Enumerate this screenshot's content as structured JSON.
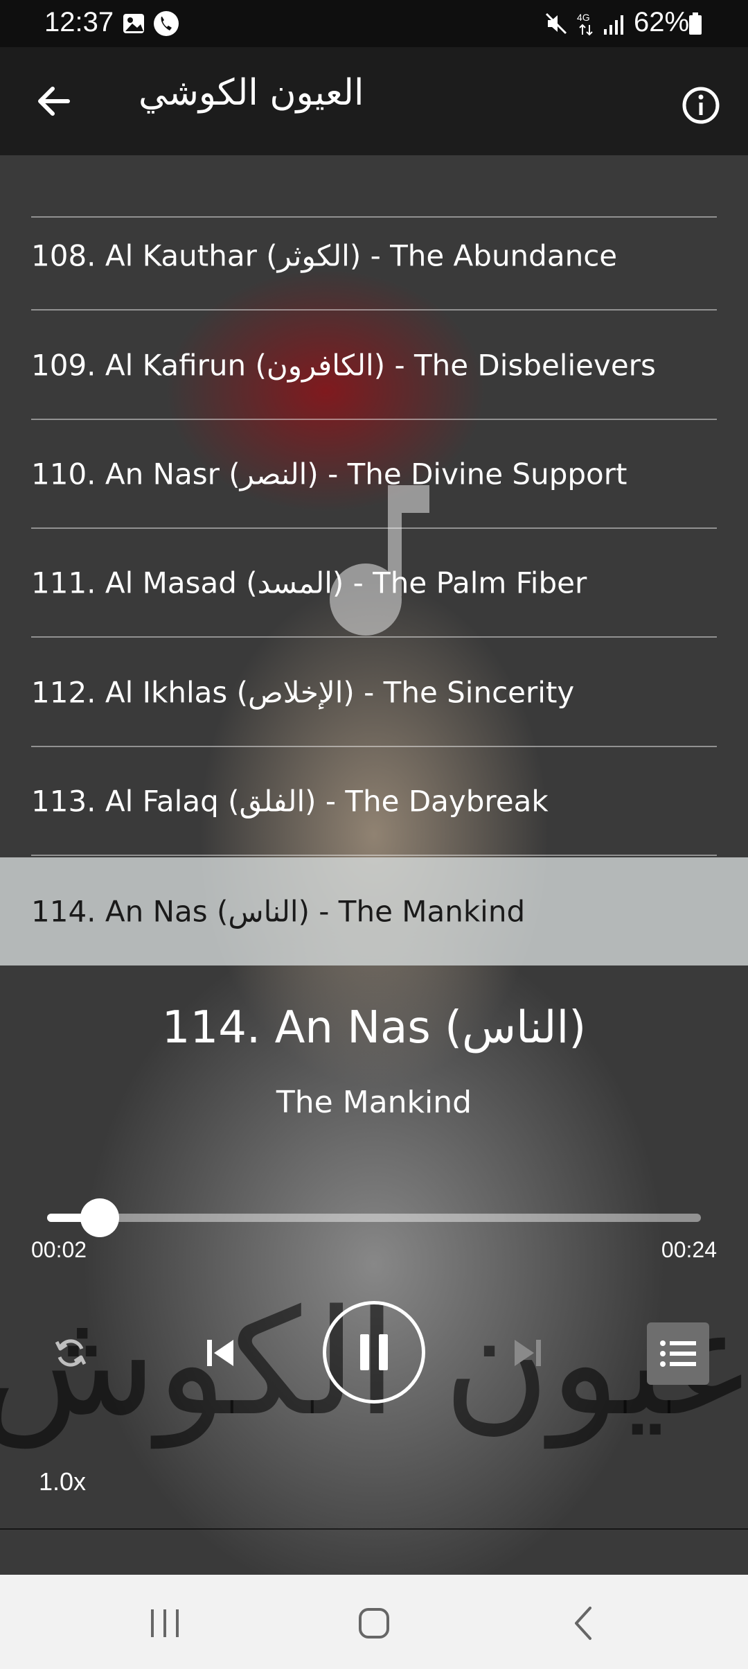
{
  "status": {
    "time": "12:37",
    "battery": "62%",
    "network": "4G"
  },
  "appbar": {
    "title": "العيون الكوشي"
  },
  "tracks": [
    {
      "label": "108. Al Kauthar (الكوثر) - The Abundance"
    },
    {
      "label": "109. Al Kafirun (الكافرون) - The Disbelievers"
    },
    {
      "label": "110. An Nasr (النصر) - The Divine Support"
    },
    {
      "label": "111. Al Masad (المسد) - The Palm Fiber"
    },
    {
      "label": "112. Al Ikhlas (الإخلاص) - The Sincerity"
    },
    {
      "label": "113. Al Falaq (الفلق) - The Daybreak"
    },
    {
      "label": "114. An Nas (الناس) - The Mankind"
    }
  ],
  "now_playing": {
    "title": "114. An Nas (الناس)",
    "subtitle": "The Mankind",
    "current_time": "00:02",
    "duration": "00:24",
    "progress_fraction": 0.08,
    "speed": "1.0x"
  },
  "icons": {
    "back": "arrow-left-icon",
    "info": "info-icon",
    "repeat": "repeat-icon",
    "previous": "skip-previous-icon",
    "play_pause": "pause-icon",
    "next": "skip-next-icon",
    "playlist": "playlist-icon"
  },
  "colors": {
    "app_bar": "#1c1c1c",
    "selected_row": "#d7dcdc",
    "nav_bar": "#f2f2f2"
  }
}
